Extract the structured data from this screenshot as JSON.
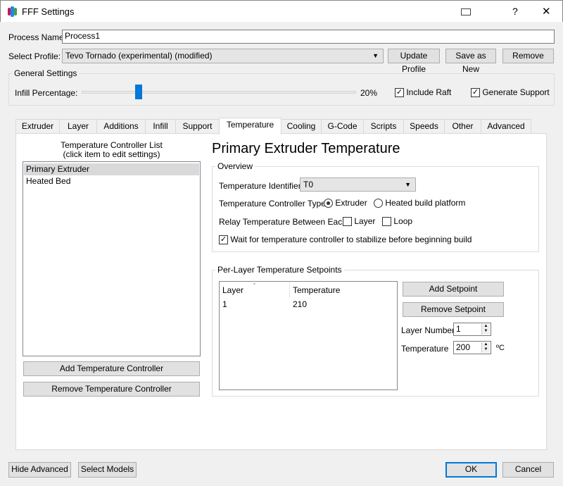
{
  "window": {
    "title": "FFF Settings",
    "help": "?",
    "close": "✕"
  },
  "process": {
    "label": "Process Name:",
    "value": "Process1"
  },
  "profile": {
    "label": "Select Profile:",
    "value": "Tevo Tornado (experimental) (modified)",
    "update": "Update Profile",
    "save_new": "Save as New",
    "remove": "Remove"
  },
  "general": {
    "title": "General Settings",
    "infill_label": "Infill Percentage:",
    "infill_value": "20%",
    "infill_percent": 20,
    "include_raft": "Include Raft",
    "generate_support": "Generate Support"
  },
  "tabs": [
    "Extruder",
    "Layer",
    "Additions",
    "Infill",
    "Support",
    "Temperature",
    "Cooling",
    "G-Code",
    "Scripts",
    "Speeds",
    "Other",
    "Advanced"
  ],
  "controllers": {
    "title": "Temperature Controller List",
    "subtitle": "(click item to edit settings)",
    "items": [
      "Primary Extruder",
      "Heated Bed"
    ],
    "add": "Add Temperature Controller",
    "remove": "Remove Temperature Controller"
  },
  "detail": {
    "heading": "Primary Extruder Temperature",
    "overview": "Overview",
    "identifier_label": "Temperature Identifier",
    "identifier_value": "T0",
    "type_label": "Temperature Controller Type:",
    "type_extruder": "Extruder",
    "type_bed": "Heated build platform",
    "relay_label": "Relay Temperature Between Each:",
    "relay_layer": "Layer",
    "relay_loop": "Loop",
    "wait_label": "Wait for temperature controller to stabilize before beginning build"
  },
  "setpoints": {
    "title": "Per-Layer Temperature Setpoints",
    "columns": [
      "Layer",
      "Temperature"
    ],
    "rows": [
      [
        "1",
        "210"
      ]
    ],
    "add": "Add Setpoint",
    "remove": "Remove Setpoint",
    "layer_label": "Layer Number",
    "layer_value": "1",
    "temp_label": "Temperature",
    "temp_value": "200",
    "unit": "ºC"
  },
  "footer": {
    "hide_advanced": "Hide Advanced",
    "select_models": "Select Models",
    "ok": "OK",
    "cancel": "Cancel"
  }
}
